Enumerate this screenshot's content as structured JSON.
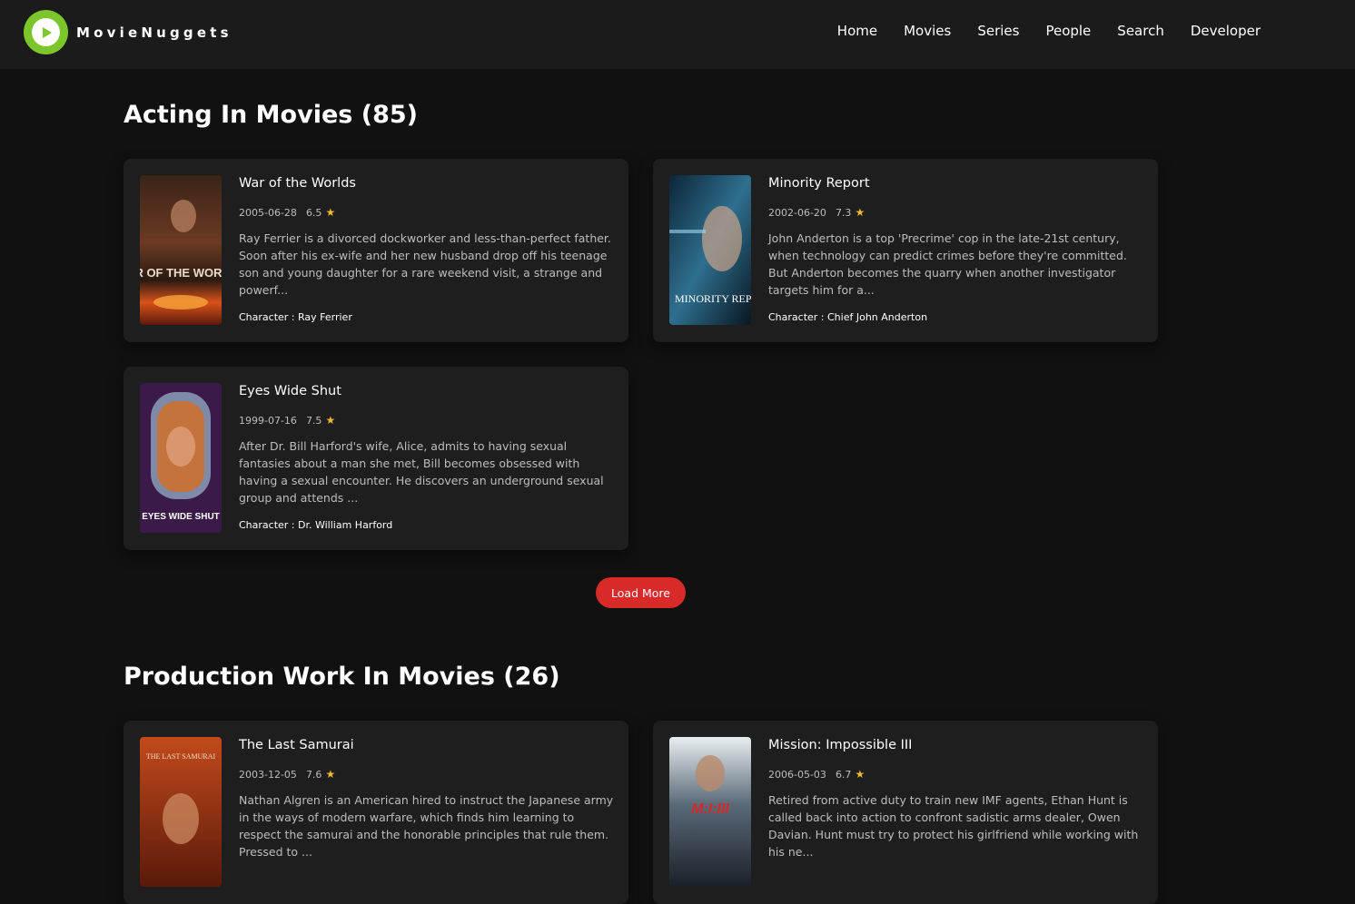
{
  "brand": {
    "name": "MovieNuggets",
    "logo_color": "#7cc62b"
  },
  "nav": [
    "Home",
    "Movies",
    "Series",
    "People",
    "Search",
    "Developer"
  ],
  "acting": {
    "title": "Acting In Movies (85)",
    "cards": [
      {
        "title": "War of the Worlds",
        "date": "2005-06-28",
        "rating": "6.5",
        "description": "Ray Ferrier is a divorced dockworker and less-than-perfect father. Soon after his ex-wife and her new husband drop off his teenage son and young daughter for a rare weekend visit, a strange and powerf...",
        "character": "Character : Ray Ferrier",
        "poster_text": "WAR OF THE WORLDS"
      },
      {
        "title": "Minority Report",
        "date": "2002-06-20",
        "rating": "7.3",
        "description": "John Anderton is a top 'Precrime' cop in the late-21st century, when technology can predict crimes before they're committed. But Anderton becomes the quarry when another investigator targets him for a...",
        "character": "Character : Chief John Anderton",
        "poster_text": "MINORITY REPORT"
      },
      {
        "title": "Eyes Wide Shut",
        "date": "1999-07-16",
        "rating": "7.5",
        "description": "After Dr. Bill Harford's wife, Alice, admits to having sexual fantasies about a man she met, Bill becomes obsessed with having a sexual encounter. He discovers an underground sexual group and attends ...",
        "character": "Character : Dr. William Harford",
        "poster_text": "EYES WIDE SHUT"
      }
    ],
    "load_more": "Load More"
  },
  "production": {
    "title": "Production Work In Movies (26)",
    "cards": [
      {
        "title": "The Last Samurai",
        "date": "2003-12-05",
        "rating": "7.6",
        "description": "Nathan Algren is an American hired to instruct the Japanese army in the ways of modern warfare, which finds him learning to respect the samurai and the honorable principles that rule them. Pressed to ...",
        "poster_text": "THE LAST SAMURAI"
      },
      {
        "title": "Mission: Impossible III",
        "date": "2006-05-03",
        "rating": "6.7",
        "description": "Retired from active duty to train new IMF agents, Ethan Hunt is called back into action to confront sadistic arms dealer, Owen Davian. Hunt must try to protect his girlfriend while working with his ne...",
        "poster_text": "M:I:III"
      }
    ]
  },
  "colors": {
    "background": "#111111",
    "card": "#1e1e1e",
    "accent_button": "#d92a2a",
    "star": "#f5b82e"
  }
}
